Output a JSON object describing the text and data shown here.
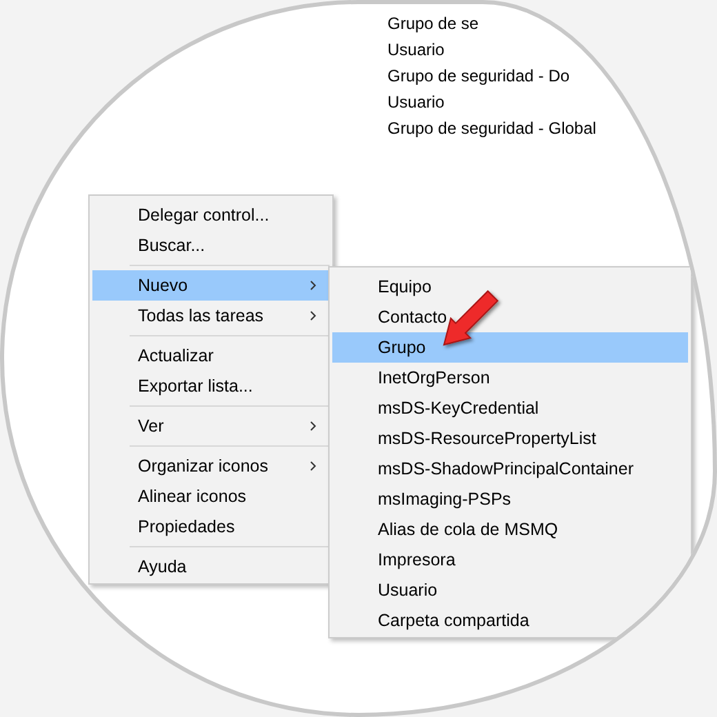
{
  "background_list": {
    "items": [
      "Grupo de se",
      "Usuario",
      "Grupo de seguridad - Do",
      "Usuario",
      "Grupo de seguridad - Global"
    ]
  },
  "context_menu": {
    "items": [
      {
        "kind": "item",
        "label": "Delegar control...",
        "submenu": false,
        "selected": false
      },
      {
        "kind": "item",
        "label": "Buscar...",
        "submenu": false,
        "selected": false
      },
      {
        "kind": "separator"
      },
      {
        "kind": "item",
        "label": "Nuevo",
        "submenu": true,
        "selected": true
      },
      {
        "kind": "item",
        "label": "Todas las tareas",
        "submenu": true,
        "selected": false
      },
      {
        "kind": "separator"
      },
      {
        "kind": "item",
        "label": "Actualizar",
        "submenu": false,
        "selected": false
      },
      {
        "kind": "item",
        "label": "Exportar lista...",
        "submenu": false,
        "selected": false
      },
      {
        "kind": "separator"
      },
      {
        "kind": "item",
        "label": "Ver",
        "submenu": true,
        "selected": false
      },
      {
        "kind": "separator"
      },
      {
        "kind": "item",
        "label": "Organizar iconos",
        "submenu": true,
        "selected": false
      },
      {
        "kind": "item",
        "label": "Alinear iconos",
        "submenu": false,
        "selected": false
      },
      {
        "kind": "item",
        "label": "Propiedades",
        "submenu": false,
        "selected": false
      },
      {
        "kind": "separator"
      },
      {
        "kind": "item",
        "label": "Ayuda",
        "submenu": false,
        "selected": false
      }
    ]
  },
  "submenu": {
    "items": [
      {
        "kind": "item",
        "label": "Equipo",
        "selected": false
      },
      {
        "kind": "item",
        "label": "Contacto",
        "selected": false
      },
      {
        "kind": "item",
        "label": "Grupo",
        "selected": true
      },
      {
        "kind": "item",
        "label": "InetOrgPerson",
        "selected": false
      },
      {
        "kind": "item",
        "label": "msDS-KeyCredential",
        "selected": false
      },
      {
        "kind": "item",
        "label": "msDS-ResourcePropertyList",
        "selected": false
      },
      {
        "kind": "item",
        "label": "msDS-ShadowPrincipalContainer",
        "selected": false
      },
      {
        "kind": "item",
        "label": "msImaging-PSPs",
        "selected": false
      },
      {
        "kind": "item",
        "label": "Alias de cola de MSMQ",
        "selected": false
      },
      {
        "kind": "item",
        "label": "Impresora",
        "selected": false
      },
      {
        "kind": "item",
        "label": "Usuario",
        "selected": false
      },
      {
        "kind": "item",
        "label": "Carpeta compartida",
        "selected": false
      }
    ]
  }
}
